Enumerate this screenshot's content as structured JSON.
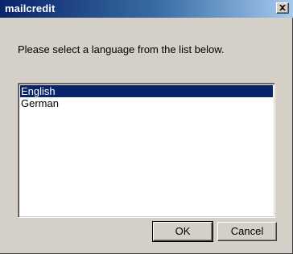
{
  "window": {
    "title": "mailcredit",
    "close_glyph": "close-icon"
  },
  "main": {
    "prompt": "Please select a language from the list below."
  },
  "language_list": {
    "items": [
      {
        "label": "English",
        "selected": true
      },
      {
        "label": "German",
        "selected": false
      }
    ]
  },
  "buttons": {
    "ok_label": "OK",
    "cancel_label": "Cancel"
  },
  "colors": {
    "face": "#d4d0c8",
    "selection": "#0a246a",
    "title_start": "#0a246a",
    "title_end": "#a6caf0"
  }
}
